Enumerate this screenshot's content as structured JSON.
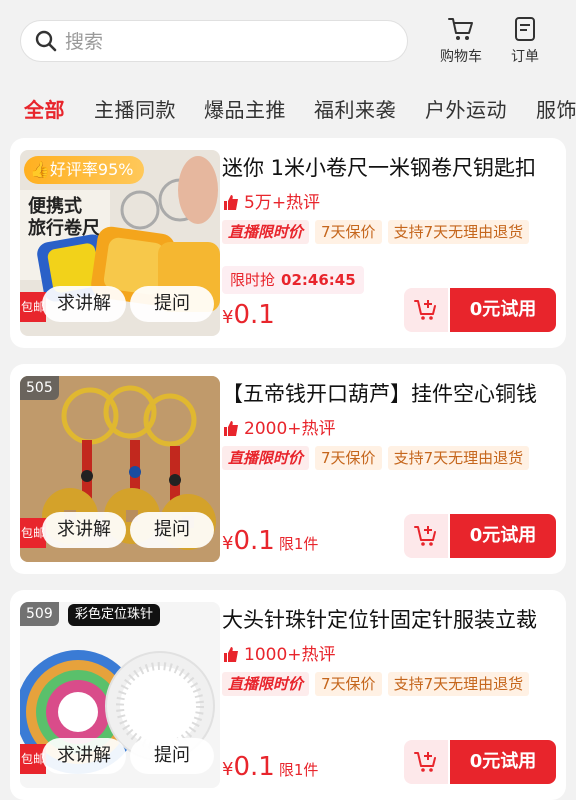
{
  "search": {
    "placeholder": "搜索"
  },
  "header": {
    "cart_label": "购物车",
    "orders_label": "订单"
  },
  "tabs": [
    {
      "label": "全部",
      "active": true
    },
    {
      "label": "主播同款"
    },
    {
      "label": "爆品主推"
    },
    {
      "label": "福利来袭"
    },
    {
      "label": "户外运动"
    },
    {
      "label": "服饰"
    }
  ],
  "colors": {
    "accent": "#e8252c",
    "tag_orange": "#c5661c",
    "rate_badge": "#ffb020"
  },
  "products": [
    {
      "title": "迷你 1米小卷尺一米钢卷尺钥匙扣",
      "hot": "5万+热评",
      "tags": [
        "直播限时价",
        "7天保价",
        "支持7天无理由退货"
      ],
      "flash_label": "限时抢",
      "flash_time": "02:46:45",
      "price_symbol": "¥",
      "price_value": "0.1",
      "limit": "",
      "try_label": "0元试用",
      "ask_label": "求讲解",
      "question_label": "提问",
      "rate_badge": "好评率95%",
      "image_text": "便携式\n旅行卷尺"
    },
    {
      "title": "【五帝钱开口葫芦】挂件空心铜钱",
      "hot": "2000+热评",
      "tags": [
        "直播限时价",
        "7天保价",
        "支持7天无理由退货"
      ],
      "price_symbol": "¥",
      "price_value": "0.1",
      "limit": "限1件",
      "try_label": "0元试用",
      "ask_label": "求讲解",
      "question_label": "提问",
      "num_badge": "505"
    },
    {
      "title": "大头针珠针定位针固定针服装立裁",
      "hot": "1000+热评",
      "tags": [
        "直播限时价",
        "7天保价",
        "支持7天无理由退货"
      ],
      "price_symbol": "¥",
      "price_value": "0.1",
      "limit": "限1件",
      "try_label": "0元试用",
      "ask_label": "求讲解",
      "question_label": "提问",
      "num_badge": "509",
      "image_tag": "彩色定位珠针"
    }
  ]
}
